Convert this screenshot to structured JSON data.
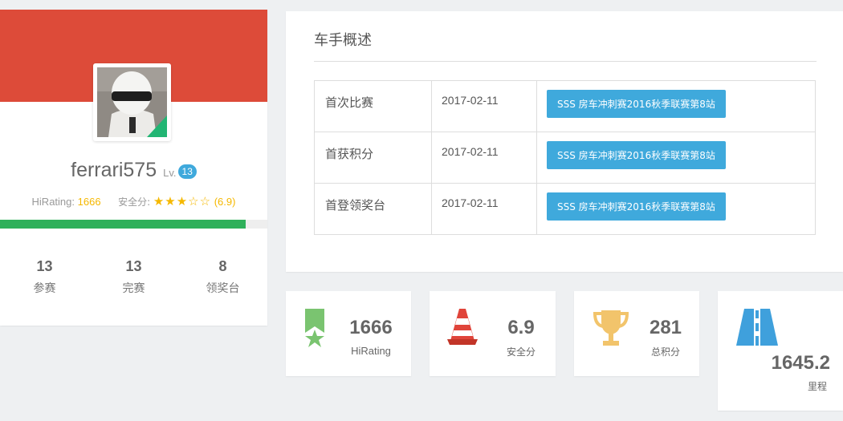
{
  "profile": {
    "username": "ferrari575",
    "level_label": "Lv.",
    "level": "13",
    "hirating_label": "HiRating:",
    "hirating": "1666",
    "safety_label": "安全分:",
    "safety_stars": "★★★☆☆",
    "safety_score": "(6.9)",
    "progress_fraction": 0.92,
    "stats": [
      {
        "value": "13",
        "label": "参赛"
      },
      {
        "value": "13",
        "label": "完赛"
      },
      {
        "value": "8",
        "label": "领奖台"
      }
    ],
    "colors": {
      "banner": "#dd4b39",
      "progress": "#2fb05a",
      "accent": "#3fa9dc",
      "star": "#f5b800"
    }
  },
  "overview": {
    "title": "车手概述",
    "rows": [
      {
        "label": "首次比赛",
        "date": "2017-02-11",
        "event": "SSS 房车冲刺赛2016秋季联赛第8站"
      },
      {
        "label": "首获积分",
        "date": "2017-02-11",
        "event": "SSS 房车冲刺赛2016秋季联赛第8站"
      },
      {
        "label": "首登领奖台",
        "date": "2017-02-11",
        "event": "SSS 房车冲刺赛2016秋季联赛第8站"
      }
    ]
  },
  "metrics": [
    {
      "icon": "medal-icon",
      "value": "1666",
      "label": "HiRating"
    },
    {
      "icon": "traffic-cone-icon",
      "value": "6.9",
      "label": "安全分"
    },
    {
      "icon": "trophy-icon",
      "value": "281",
      "label": "总积分"
    },
    {
      "icon": "road-icon",
      "value": "1645.2",
      "label": "里程"
    }
  ]
}
